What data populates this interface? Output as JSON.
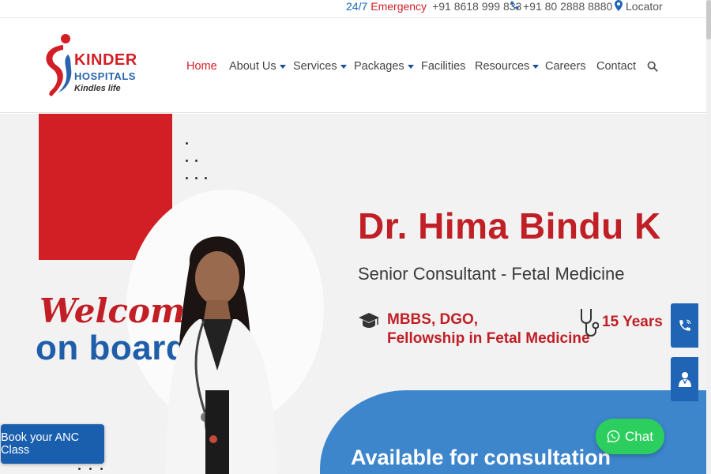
{
  "topbar": {
    "emergency_prefix": "24/7",
    "emergency_label": "Emergency",
    "emergency_number": "+91 8618 999 833",
    "phone_number": "+91 80 2888 8880",
    "locator_label": "Locator"
  },
  "logo": {
    "line1": "KINDER",
    "line2": "HOSPITALS",
    "tagline": "Kindles life"
  },
  "nav": {
    "items": [
      {
        "label": "Home"
      },
      {
        "label": "About Us"
      },
      {
        "label": "Services"
      },
      {
        "label": "Packages"
      },
      {
        "label": "Facilities"
      },
      {
        "label": "Resources"
      },
      {
        "label": "Careers"
      },
      {
        "label": "Contact"
      }
    ],
    "search_icon": "search-icon"
  },
  "hero": {
    "welcome": "Welcome",
    "on_board": "on board",
    "doctor_name": "Dr. Hima Bindu K",
    "doctor_title": "Senior Consultant - Fetal Medicine",
    "qualification_line1": "MBBS, DGO,",
    "qualification_line2": "Fellowship in Fetal Medicine",
    "experience": "15 Years",
    "availability": "Available for consultation"
  },
  "floating": {
    "anc_button": "Book your ANC Class",
    "chat_button": "Chat"
  },
  "colors": {
    "brand_red": "#d21f26",
    "brand_blue": "#1f64b5",
    "chat_green": "#2ccf5e"
  }
}
